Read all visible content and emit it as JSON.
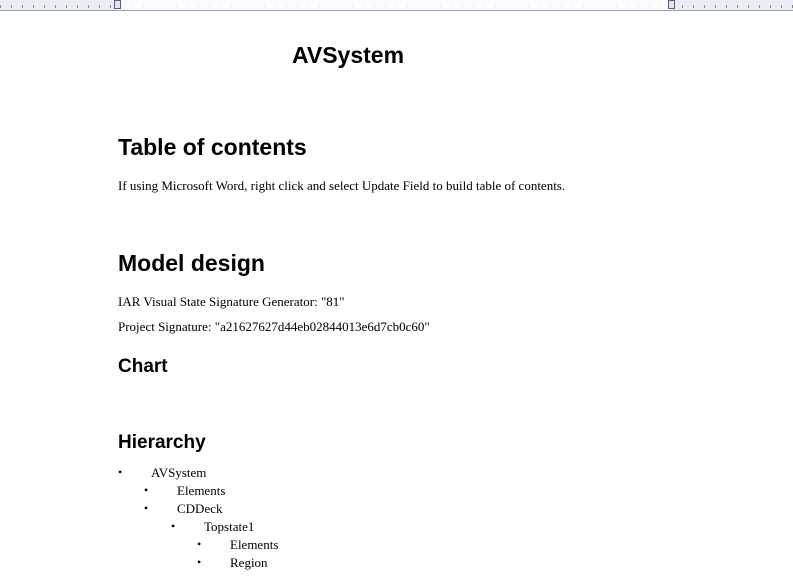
{
  "document": {
    "title": "AVSystem",
    "toc": {
      "heading": "Table of contents",
      "note": "If using Microsoft Word, right click and select Update Field to build table of contents."
    },
    "model_design": {
      "heading": "Model design",
      "generator_line": "IAR Visual State Signature Generator: \"81\"",
      "signature_line": "Project Signature: \"a21627627d44eb02844013e6d7cb0c60\"",
      "chart_heading": "Chart",
      "hierarchy_heading": "Hierarchy"
    },
    "hierarchy": [
      {
        "bullet": "•",
        "label": "AVSystem",
        "level": 0
      },
      {
        "bullet": "•",
        "label": "Elements",
        "level": 1
      },
      {
        "bullet": "•",
        "label": "CDDeck",
        "level": 1
      },
      {
        "bullet": "•",
        "label": "Topstate1",
        "level": 2
      },
      {
        "bullet": "•",
        "label": "Elements",
        "level": 3
      },
      {
        "bullet": "•",
        "label": "Region",
        "level": 3
      }
    ]
  }
}
